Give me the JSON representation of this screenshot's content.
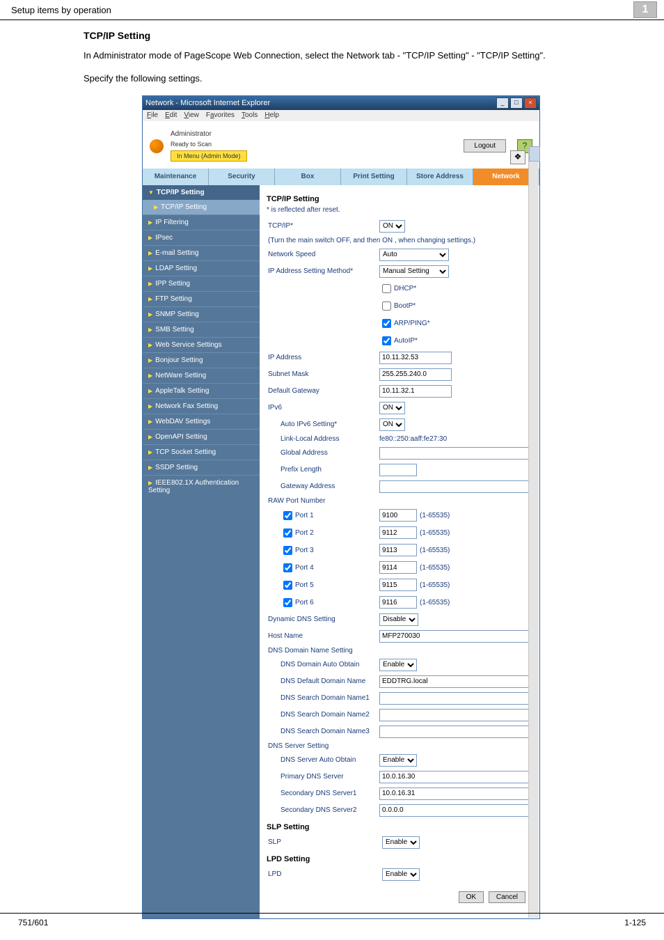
{
  "header": {
    "breadcrumb": "Setup items by operation",
    "chapter": "1"
  },
  "intro": {
    "title": "TCP/IP Setting",
    "p1": "In Administrator mode of PageScope Web Connection, select the Network tab - \"TCP/IP Setting\" - \"TCP/IP Setting\".",
    "p2": "Specify the following settings."
  },
  "footer": {
    "left": "751/601",
    "right": "1-125"
  },
  "window": {
    "title": "Network - Microsoft Internet Explorer",
    "menus": {
      "file": "File",
      "edit": "Edit",
      "view": "View",
      "fav": "Favorites",
      "tools": "Tools",
      "help": "Help"
    },
    "role": "Administrator",
    "ready": "Ready to Scan",
    "mode": "In Menu (Admin Mode)",
    "logout": "Logout"
  },
  "tabs": {
    "maint": "Maintenance",
    "sec": "Security",
    "box": "Box",
    "print": "Print Setting",
    "store": "Store Address",
    "network": "Network"
  },
  "sidebar": {
    "top": "TCP/IP Setting",
    "sub": "TCP/IP Setting",
    "items": [
      "IP Filtering",
      "IPsec",
      "E-mail Setting",
      "LDAP Setting",
      "IPP Setting",
      "FTP Setting",
      "SNMP Setting",
      "SMB Setting",
      "Web Service Settings",
      "Bonjour Setting",
      "NetWare Setting",
      "AppleTalk Setting",
      "Network Fax Setting",
      "WebDAV Settings",
      "OpenAPI Setting",
      "TCP Socket Setting",
      "SSDP Setting",
      "IEEE802.1X Authentication Setting"
    ]
  },
  "form": {
    "heading": "TCP/IP Setting",
    "reflect": "* is reflected after reset.",
    "tcpip_lbl": "TCP/IP*",
    "tcpip_val": "ON",
    "switchnote": "(Turn the main switch OFF, and then ON , when changing settings.)",
    "netspeed_lbl": "Network Speed",
    "netspeed_val": "Auto",
    "ipmethod_lbl": "IP Address Setting Method*",
    "ipmethod_val": "Manual Setting",
    "dhcp": "DHCP*",
    "bootp": "BootP*",
    "arp": "ARP/PING*",
    "autoip": "AutoIP*",
    "ipaddr_lbl": "IP Address",
    "ipaddr_val": "10.11.32.53",
    "subnet_lbl": "Subnet Mask",
    "subnet_val": "255.255.240.0",
    "gateway_lbl": "Default Gateway",
    "gateway_val": "10.11.32.1",
    "ipv6_lbl": "IPv6",
    "ipv6_val": "ON",
    "auto6_lbl": "Auto IPv6 Setting*",
    "auto6_val": "ON",
    "llocal_lbl": "Link-Local Address",
    "llocal_val": "fe80::250:aaff:fe27:30",
    "global_lbl": "Global Address",
    "global_val": "",
    "plen_lbl": "Prefix Length",
    "plen_val": "",
    "gaddr_lbl": "Gateway Address",
    "gaddr_val": "",
    "raw_lbl": "RAW Port Number",
    "ports": [
      {
        "lbl": "Port 1",
        "val": "9100",
        "rng": "(1-65535)"
      },
      {
        "lbl": "Port 2",
        "val": "9112",
        "rng": "(1-65535)"
      },
      {
        "lbl": "Port 3",
        "val": "9113",
        "rng": "(1-65535)"
      },
      {
        "lbl": "Port 4",
        "val": "9114",
        "rng": "(1-65535)"
      },
      {
        "lbl": "Port 5",
        "val": "9115",
        "rng": "(1-65535)"
      },
      {
        "lbl": "Port 6",
        "val": "9116",
        "rng": "(1-65535)"
      }
    ],
    "ddns_lbl": "Dynamic DNS Setting",
    "ddns_val": "Disable",
    "host_lbl": "Host Name",
    "host_val": "MFP270030",
    "dnsdomain_lbl": "DNS Domain Name Setting",
    "ddauto_lbl": "DNS Domain Auto Obtain",
    "ddauto_val": "Enable",
    "dddef_lbl": "DNS Default Domain Name",
    "dddef_val": "EDDTRG.local",
    "dds1_lbl": "DNS Search Domain Name1",
    "dds1_val": "",
    "dds2_lbl": "DNS Search Domain Name2",
    "dds2_val": "",
    "dds3_lbl": "DNS Search Domain Name3",
    "dds3_val": "",
    "dnssrv_lbl": "DNS Server Setting",
    "dsauto_lbl": "DNS Server Auto Obtain",
    "dsauto_val": "Enable",
    "pri_lbl": "Primary DNS Server",
    "pri_val": "10.0.16.30",
    "sec1_lbl": "Secondary DNS Server1",
    "sec1_val": "10.0.16.31",
    "sec2_lbl": "Secondary DNS Server2",
    "sec2_val": "0.0.0.0",
    "slp_head": "SLP Setting",
    "slp_lbl": "SLP",
    "slp_val": "Enable",
    "lpd_head": "LPD Setting",
    "lpd_lbl": "LPD",
    "lpd_val": "Enable",
    "ok": "OK",
    "cancel": "Cancel"
  }
}
